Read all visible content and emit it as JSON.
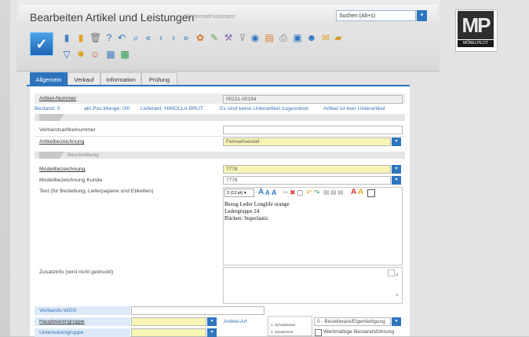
{
  "header": {
    "title": "Bearbeiten Artikel und Leistungen",
    "user": "Systemadministrator",
    "search_value": "Suchen (Alt+s)",
    "logo_text": "MP",
    "logo_sub": "MÖBELPILOT"
  },
  "toolbar": {
    "icons": [
      "check-icon",
      "document-icon",
      "notes-icon",
      "trash-icon",
      "help-icon",
      "back-arrow-icon",
      "search-icon",
      "first-icon",
      "prev-icon",
      "next-icon",
      "last-icon",
      "colors-icon",
      "pencil-icon",
      "tools-icon",
      "filter-icon",
      "globe-icon",
      "chart-icon",
      "print-icon",
      "stamp-icon",
      "person-icon",
      "mail-icon",
      "pdf-icon",
      "filter2-icon",
      "flower-icon",
      "smiley-icon",
      "image-icon",
      "grid-icon"
    ]
  },
  "tabs": [
    {
      "label": "Allgemein",
      "active": true
    },
    {
      "label": "Verkauf",
      "active": false
    },
    {
      "label": "Information",
      "active": false
    },
    {
      "label": "Prüfung",
      "active": false
    }
  ],
  "form": {
    "artikelnummer_label": "Artikel-Nummer",
    "artikelnummer_value": "00231-00194",
    "bestand": "Bestand: 0",
    "pos_menge": "akt.Pos.Menge: 0/0",
    "lieferant": "Lieferant: HIMOLLA BRUT",
    "unterartikel1": "Es sind keine Unterartikel zugeordnet",
    "unterartikel2": "Artikel ist kein Unterartikel",
    "verbands_label": "Verbandsartikelnummer",
    "verbands_value": "",
    "artikelbez_label": "Artikelbezeichnung",
    "artikelbez_value": "Fernsehsessel",
    "beschreibung_label": "Beschreibung",
    "modellbez_label": "Modellbezeichnung",
    "modellbez_value": "7778",
    "modellbez_kunde_label": "Modellbezeichnung Kunde",
    "modellbez_kunde_value": "7778",
    "text_label": "Text (für Bestellung, Lieferpapiere und Etiketten)",
    "font_size": "3 (12 pt)",
    "text_lines": [
      "Bezug Leder Longlife orange",
      "Ledergruppe 24",
      "Rücken: Superlastic"
    ],
    "zusatzinfo_label": "Zusatzinfo (wird nicht gedruckt)",
    "verbands_wgs_label": "Verbands-WGS",
    "hauptwarengruppe_label": "Hauptwarengruppe",
    "unterwarengruppe_label": "Unterwarengruppe",
    "artikel_art_label": "Artikel-Art",
    "artikel_art_list": [
      "1. Schrankinner",
      "2. Zusatzinner"
    ],
    "bestellware_value": "0 - Bestellware/Eigenfertigung",
    "wertmaessige_label": "Wertmäßige Bestandsführung"
  }
}
